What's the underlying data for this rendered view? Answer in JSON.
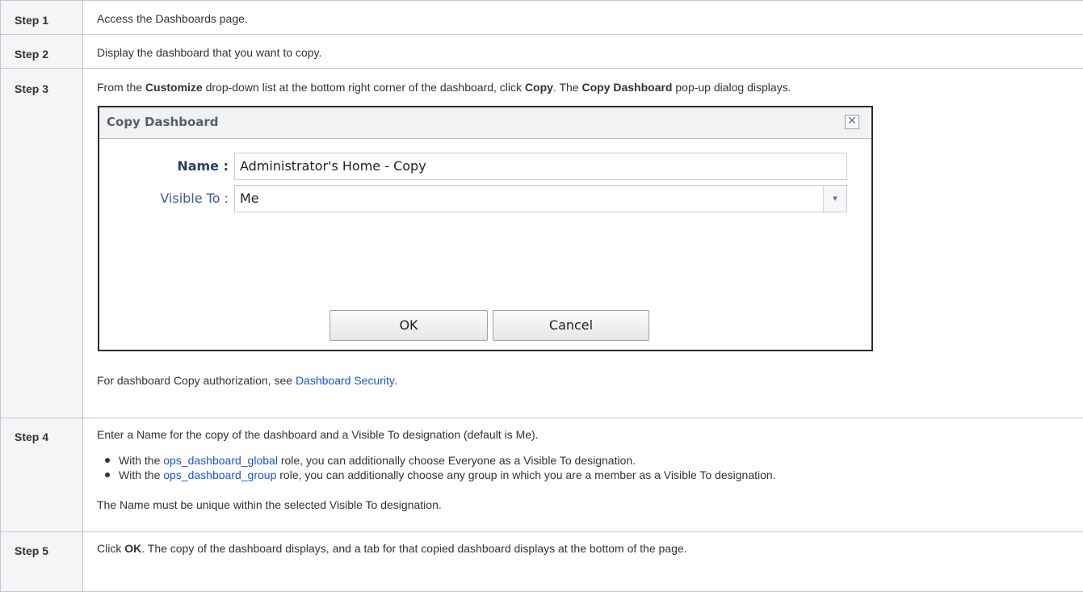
{
  "steps": [
    {
      "label": "Step 1",
      "text": "Access the Dashboards page."
    },
    {
      "label": "Step 2",
      "text": "Display the dashboard that you want to copy."
    },
    {
      "label": "Step 3",
      "intro": {
        "t1": "From the ",
        "b1": "Customize",
        "t2": " drop-down list at the bottom right corner of the dashboard, click ",
        "b2": "Copy",
        "t3": ". The ",
        "b3": "Copy Dashboard",
        "t4": " pop-up dialog displays."
      },
      "dialog": {
        "title": "Copy Dashboard",
        "close_glyph": "✕",
        "name_label": "Name :",
        "name_value": "Administrator's Home - Copy",
        "visible_label": "Visible To :",
        "visible_value": "Me",
        "dropdown_glyph": "▾",
        "ok_label": "OK",
        "cancel_label": "Cancel"
      },
      "note": {
        "t1": "For dashboard Copy authorization, see ",
        "link": "Dashboard Security",
        "t2": "."
      }
    },
    {
      "label": "Step 4",
      "intro": "Enter a Name for the copy of the dashboard and a Visible To designation (default is Me).",
      "bullets": [
        {
          "t1": "With the ",
          "link": "ops_dashboard_global",
          "t2": " role, you can additionally choose Everyone as a Visible To designation."
        },
        {
          "t1": "With the ",
          "link": "ops_dashboard_group",
          "t2": " role, you can additionally choose any group in which you are a member as a Visible To designation."
        }
      ],
      "note": "The Name must be unique within the selected Visible To designation."
    },
    {
      "label": "Step 5",
      "intro": {
        "t1": "Click ",
        "b1": "OK",
        "t2": ". The copy of the dashboard displays, and a tab for that copied dashboard displays at the bottom of the page."
      }
    }
  ],
  "colors": {
    "header_bg": "#f4f5f7",
    "border": "#c1c7d0",
    "link": "#1558d6",
    "text": "#333333"
  }
}
